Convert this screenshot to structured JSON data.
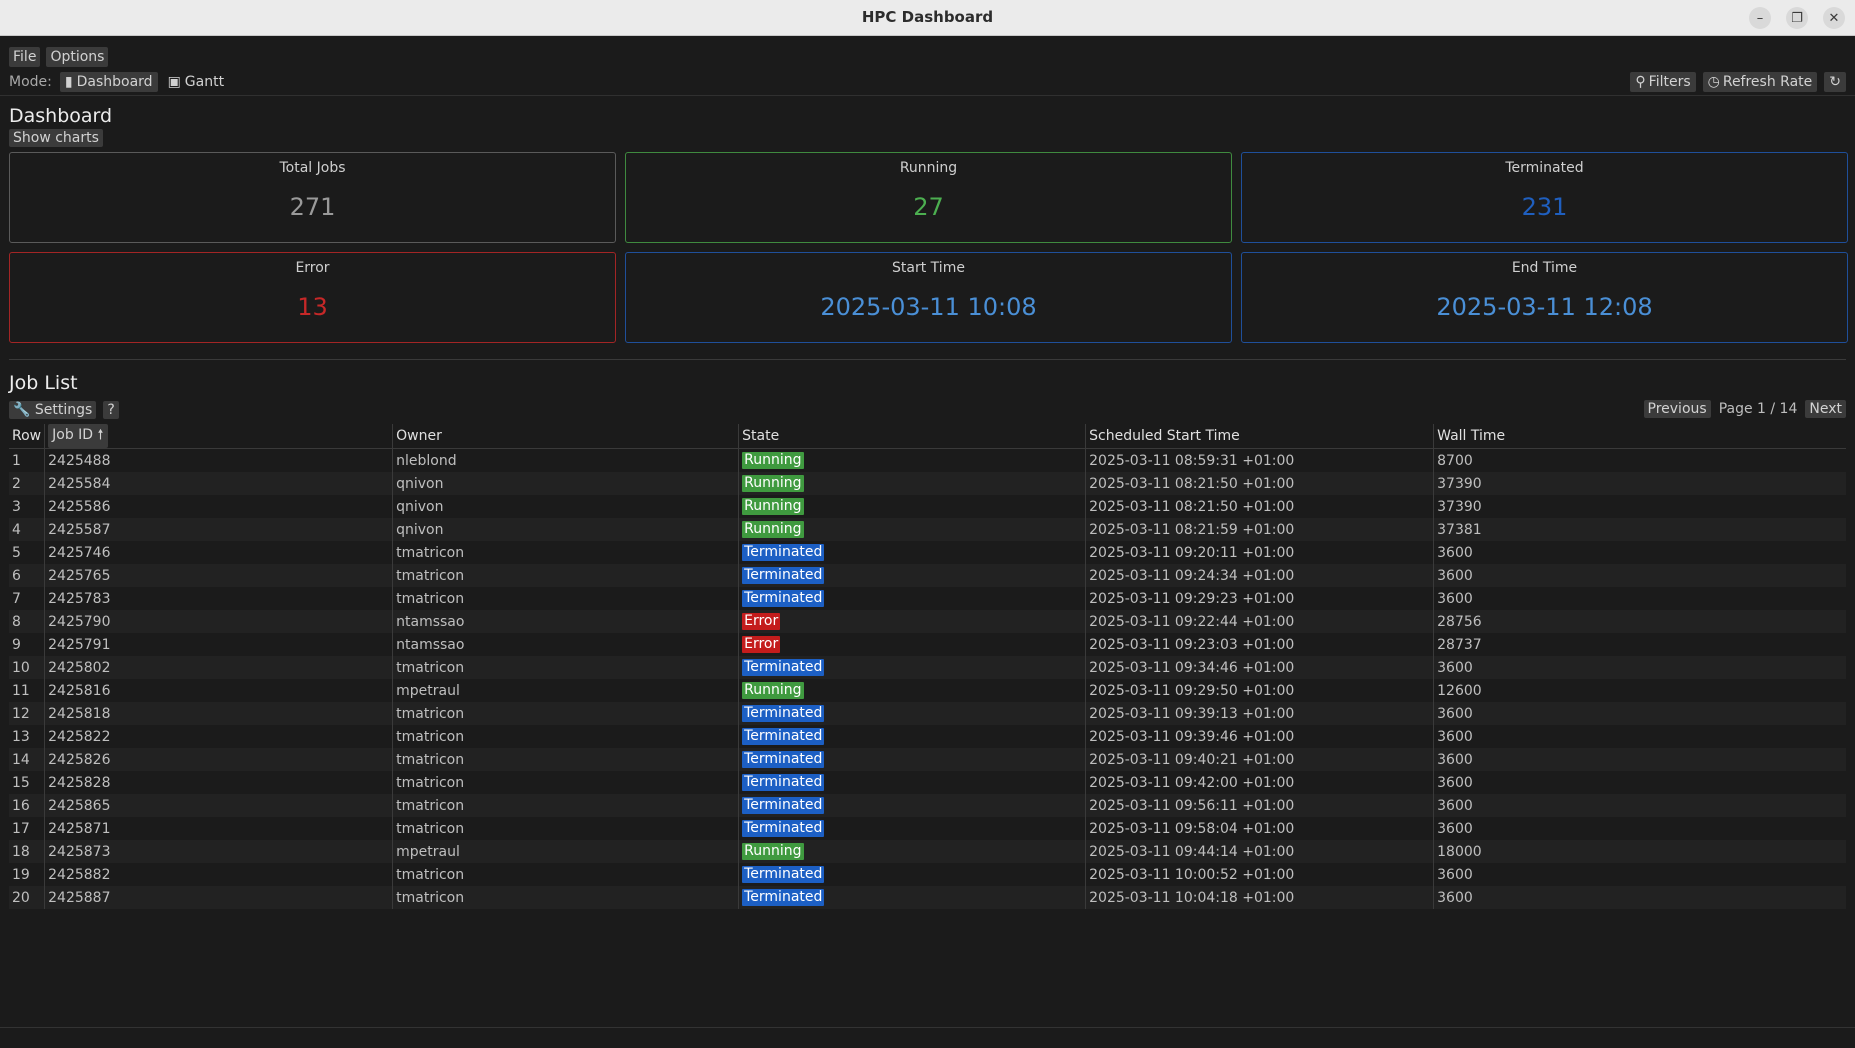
{
  "window": {
    "title": "HPC Dashboard"
  },
  "menu": {
    "file": "File",
    "options": "Options"
  },
  "modebar": {
    "label": "Mode:",
    "dashboard": "Dashboard",
    "gantt": "Gantt",
    "filters": "Filters",
    "refresh_rate": "Refresh Rate"
  },
  "dashboard": {
    "title": "Dashboard",
    "show_charts": "Show charts",
    "cards": [
      {
        "label": "Total Jobs",
        "value": "271",
        "color": "#9a9a9a",
        "border": "#5a5a5a"
      },
      {
        "label": "Running",
        "value": "27",
        "color": "#4caf50",
        "border": "#3f8a3f"
      },
      {
        "label": "Terminated",
        "value": "231",
        "color": "#1f5fbf",
        "border": "#1f4f9a"
      },
      {
        "label": "Error",
        "value": "13",
        "color": "#c62828",
        "border": "#a32525"
      },
      {
        "label": "Start Time",
        "value": "2025-03-11 10:08",
        "color": "#4a8fd6",
        "border": "#1f4f9a"
      },
      {
        "label": "End Time",
        "value": "2025-03-11 12:08",
        "color": "#4a8fd6",
        "border": "#1f4f9a"
      }
    ]
  },
  "joblist": {
    "title": "Job List",
    "settings": "Settings",
    "help": "?",
    "previous": "Previous",
    "page_info": "Page 1 / 14",
    "next": "Next",
    "columns": {
      "row": "Row",
      "job_id": "Job ID",
      "owner": "Owner",
      "state": "State",
      "start": "Scheduled Start Time",
      "wall": "Wall Time"
    },
    "state_colors": {
      "Running": "#3f9a3f",
      "Terminated": "#1c5fc4",
      "Error": "#c41c1c"
    },
    "rows": [
      {
        "row": "1",
        "id": "2425488",
        "owner": "nleblond",
        "state": "Running",
        "start": "2025-03-11 08:59:31 +01:00",
        "wall": "8700"
      },
      {
        "row": "2",
        "id": "2425584",
        "owner": "qnivon",
        "state": "Running",
        "start": "2025-03-11 08:21:50 +01:00",
        "wall": "37390"
      },
      {
        "row": "3",
        "id": "2425586",
        "owner": "qnivon",
        "state": "Running",
        "start": "2025-03-11 08:21:50 +01:00",
        "wall": "37390"
      },
      {
        "row": "4",
        "id": "2425587",
        "owner": "qnivon",
        "state": "Running",
        "start": "2025-03-11 08:21:59 +01:00",
        "wall": "37381"
      },
      {
        "row": "5",
        "id": "2425746",
        "owner": "tmatricon",
        "state": "Terminated",
        "start": "2025-03-11 09:20:11 +01:00",
        "wall": "3600"
      },
      {
        "row": "6",
        "id": "2425765",
        "owner": "tmatricon",
        "state": "Terminated",
        "start": "2025-03-11 09:24:34 +01:00",
        "wall": "3600"
      },
      {
        "row": "7",
        "id": "2425783",
        "owner": "tmatricon",
        "state": "Terminated",
        "start": "2025-03-11 09:29:23 +01:00",
        "wall": "3600"
      },
      {
        "row": "8",
        "id": "2425790",
        "owner": "ntamssao",
        "state": "Error",
        "start": "2025-03-11 09:22:44 +01:00",
        "wall": "28756"
      },
      {
        "row": "9",
        "id": "2425791",
        "owner": "ntamssao",
        "state": "Error",
        "start": "2025-03-11 09:23:03 +01:00",
        "wall": "28737"
      },
      {
        "row": "10",
        "id": "2425802",
        "owner": "tmatricon",
        "state": "Terminated",
        "start": "2025-03-11 09:34:46 +01:00",
        "wall": "3600"
      },
      {
        "row": "11",
        "id": "2425816",
        "owner": "mpetraul",
        "state": "Running",
        "start": "2025-03-11 09:29:50 +01:00",
        "wall": "12600"
      },
      {
        "row": "12",
        "id": "2425818",
        "owner": "tmatricon",
        "state": "Terminated",
        "start": "2025-03-11 09:39:13 +01:00",
        "wall": "3600"
      },
      {
        "row": "13",
        "id": "2425822",
        "owner": "tmatricon",
        "state": "Terminated",
        "start": "2025-03-11 09:39:46 +01:00",
        "wall": "3600"
      },
      {
        "row": "14",
        "id": "2425826",
        "owner": "tmatricon",
        "state": "Terminated",
        "start": "2025-03-11 09:40:21 +01:00",
        "wall": "3600"
      },
      {
        "row": "15",
        "id": "2425828",
        "owner": "tmatricon",
        "state": "Terminated",
        "start": "2025-03-11 09:42:00 +01:00",
        "wall": "3600"
      },
      {
        "row": "16",
        "id": "2425865",
        "owner": "tmatricon",
        "state": "Terminated",
        "start": "2025-03-11 09:56:11 +01:00",
        "wall": "3600"
      },
      {
        "row": "17",
        "id": "2425871",
        "owner": "tmatricon",
        "state": "Terminated",
        "start": "2025-03-11 09:58:04 +01:00",
        "wall": "3600"
      },
      {
        "row": "18",
        "id": "2425873",
        "owner": "mpetraul",
        "state": "Running",
        "start": "2025-03-11 09:44:14 +01:00",
        "wall": "18000"
      },
      {
        "row": "19",
        "id": "2425882",
        "owner": "tmatricon",
        "state": "Terminated",
        "start": "2025-03-11 10:00:52 +01:00",
        "wall": "3600"
      },
      {
        "row": "20",
        "id": "2425887",
        "owner": "tmatricon",
        "state": "Terminated",
        "start": "2025-03-11 10:04:18 +01:00",
        "wall": "3600"
      }
    ]
  }
}
